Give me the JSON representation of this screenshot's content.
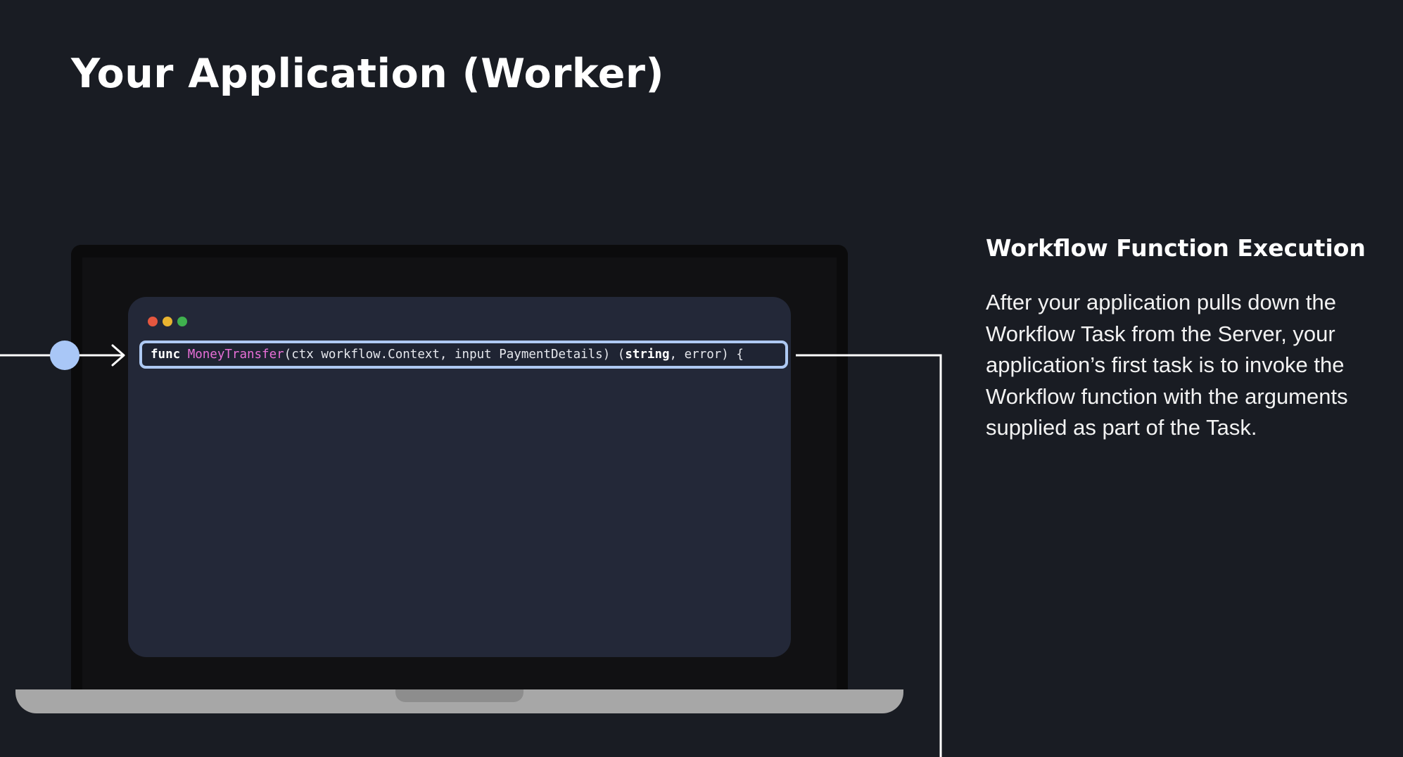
{
  "title": "Your Application (Worker)",
  "code": {
    "keyword_func": "func",
    "function_name": "MoneyTransfer",
    "params": "(ctx workflow.Context, input PaymentDetails) (",
    "keyword_string": "string",
    "tail": ", error) {"
  },
  "sidebar": {
    "heading": "Workflow Function Execution",
    "body": "After your application pulls down the Workflow Task from the Server, your application’s first task is to invoke the Workflow function with the arguments supplied as part of the Task."
  },
  "colors": {
    "background": "#191c23",
    "code_window": "#232838",
    "highlight_border": "#aec9f3",
    "function_name": "#e86fd8",
    "node": "#a9c7f7",
    "connector": "#ffffff"
  },
  "icons": {
    "window_controls": [
      "red-dot",
      "yellow-dot",
      "green-dot"
    ],
    "input_node": "circle-node-icon",
    "arrow": "arrow-right-icon"
  }
}
